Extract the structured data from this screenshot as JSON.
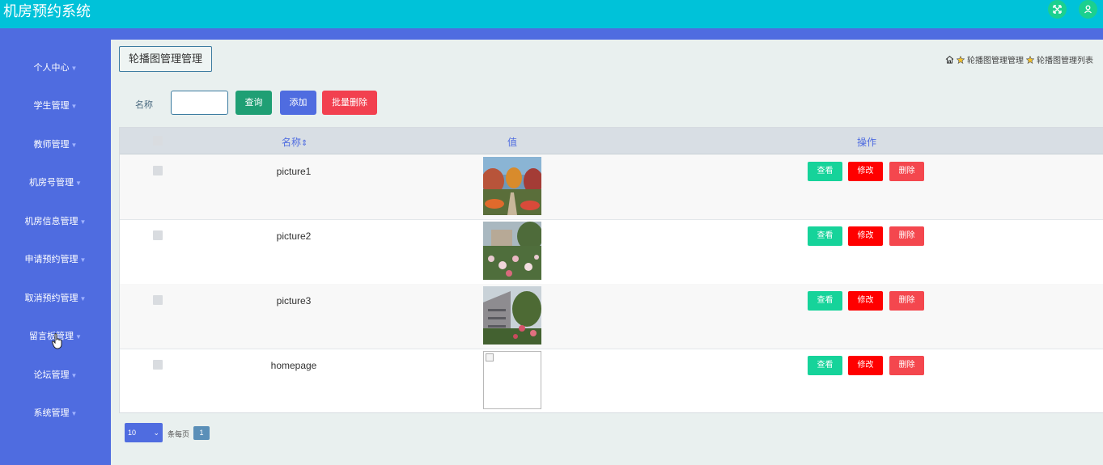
{
  "app": {
    "title": "机房预约系统"
  },
  "header_icons": [
    "fullscreen-icon",
    "user-icon"
  ],
  "sidebar": {
    "items": [
      {
        "label": "个人中心"
      },
      {
        "label": "学生管理"
      },
      {
        "label": "教师管理"
      },
      {
        "label": "机房号管理"
      },
      {
        "label": "机房信息管理"
      },
      {
        "label": "申请预约管理"
      },
      {
        "label": "取消预约管理"
      },
      {
        "label": "留言板管理"
      },
      {
        "label": "论坛管理"
      },
      {
        "label": "系统管理"
      }
    ]
  },
  "page": {
    "title": "轮播图管理管理",
    "breadcrumb": [
      "轮播图管理管理",
      "轮播图管理列表"
    ]
  },
  "search": {
    "label": "名称",
    "value": "",
    "query_button": "查询",
    "add_button": "添加",
    "batch_delete_button": "批量删除"
  },
  "table": {
    "headers": [
      "名称",
      "值",
      "操作"
    ],
    "sort_indicator": "⇕",
    "rows": [
      {
        "name": "picture1",
        "image": "campus-autumn-garden",
        "actions": [
          "查看",
          "修改",
          "删除"
        ]
      },
      {
        "name": "picture2",
        "image": "campus-flower-bushes",
        "actions": [
          "查看",
          "修改",
          "删除"
        ]
      },
      {
        "name": "picture3",
        "image": "campus-building-roses",
        "actions": [
          "查看",
          "修改",
          "删除"
        ]
      },
      {
        "name": "homepage",
        "image": "broken-image",
        "actions": [
          "查看",
          "修改",
          "删除"
        ]
      }
    ]
  },
  "pagination": {
    "page_size": "10",
    "per_page_label": "条每页",
    "current_page": "1"
  },
  "colors": {
    "topbar": "#00c2d9",
    "sidebar": "#4f6ce0",
    "query": "#1f9f74",
    "add": "#4f6ce0",
    "batch_delete": "#f2404f",
    "view": "#16d39a",
    "edit": "#ff0000",
    "delete": "#f4474e"
  }
}
